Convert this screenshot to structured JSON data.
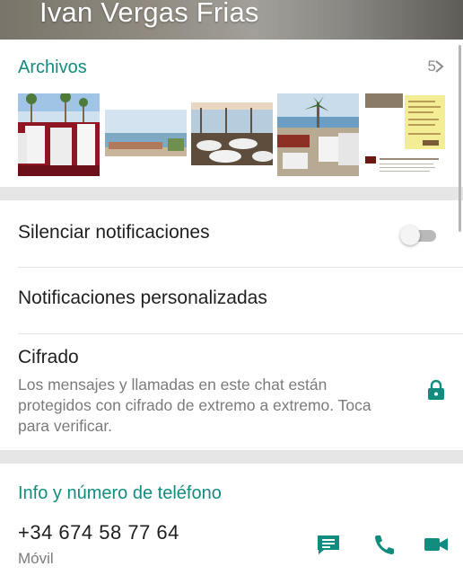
{
  "header": {
    "title": "Ivan Vergas Frias"
  },
  "media": {
    "title": "Archivos",
    "count": "5",
    "thumbnails": [
      "beach-banquet-photo",
      "beach-terrace-photo",
      "restaurant-hall-photo",
      "palm-terrace-photo",
      "document-page-photo"
    ]
  },
  "settings": {
    "mute_label": "Silenciar notificaciones",
    "mute_enabled": false,
    "custom_label": "Notificaciones personalizadas",
    "encryption_title": "Cifrado",
    "encryption_desc": "Los mensajes y llamadas en este chat están protegidos con cifrado de extremo a extremo. Toca para verificar."
  },
  "info": {
    "title": "Info y número de teléfono",
    "phone": "+34 674 58 77 64",
    "phone_type": "Móvil"
  },
  "colors": {
    "accent": "#128c7e",
    "text": "#1f1f1f",
    "muted": "#7b7b7b"
  },
  "icons": [
    "chevron-right-icon",
    "lock-icon",
    "message-icon",
    "phone-icon",
    "video-icon"
  ]
}
